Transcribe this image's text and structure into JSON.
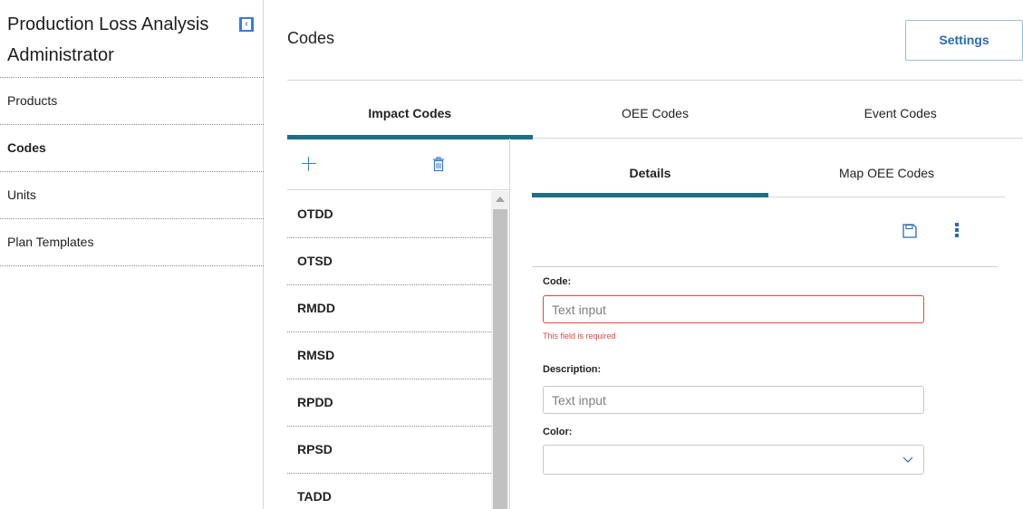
{
  "sidebar": {
    "title": "Production Loss Analysis Administrator",
    "collapse_icon": "chevron-left-icon",
    "items": [
      {
        "label": "Products",
        "active": false
      },
      {
        "label": "Codes",
        "active": true
      },
      {
        "label": "Units",
        "active": false
      },
      {
        "label": "Plan Templates",
        "active": false
      }
    ]
  },
  "header": {
    "title": "Codes",
    "settings_label": "Settings"
  },
  "tabs": [
    {
      "label": "Impact Codes",
      "active": true
    },
    {
      "label": "OEE Codes",
      "active": false
    },
    {
      "label": "Event Codes",
      "active": false
    }
  ],
  "code_list": {
    "add_icon": "plus-icon",
    "delete_icon": "trash-icon",
    "items": [
      "OTDD",
      "OTSD",
      "RMDD",
      "RMSD",
      "RPDD",
      "RPSD",
      "TADD"
    ]
  },
  "detail": {
    "tabs": [
      {
        "label": "Details",
        "active": true
      },
      {
        "label": "Map OEE Codes",
        "active": false
      }
    ],
    "save_icon": "save-icon",
    "more_icon": "more-vertical-icon",
    "code": {
      "label": "Code:",
      "value": "",
      "placeholder": "Text input",
      "error": "This field is required"
    },
    "description": {
      "label": "Description:",
      "value": "",
      "placeholder": "Text input"
    },
    "color": {
      "label": "Color:",
      "value": ""
    }
  },
  "colors": {
    "accent": "#1e6e84",
    "link": "#2a6bb5",
    "error": "#e04848"
  }
}
